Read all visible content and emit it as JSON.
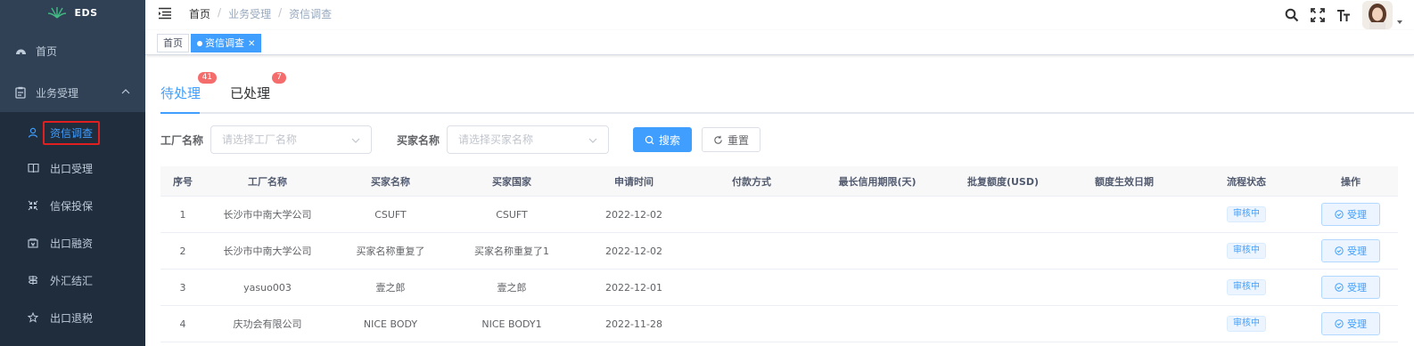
{
  "app": {
    "name": "EDS"
  },
  "sidebar": {
    "items": [
      {
        "label": "首页",
        "icon": "dashboard-icon"
      },
      {
        "label": "业务受理",
        "icon": "clipboard-icon"
      }
    ],
    "subitems": [
      {
        "label": "资信调查",
        "icon": "user-icon",
        "active": true
      },
      {
        "label": "出口受理",
        "icon": "book-icon"
      },
      {
        "label": "信保投保",
        "icon": "shrink-icon"
      },
      {
        "label": "出口融资",
        "icon": "money-icon"
      },
      {
        "label": "外汇结汇",
        "icon": "guide-icon"
      },
      {
        "label": "出口退税",
        "icon": "star-icon"
      }
    ]
  },
  "header": {
    "breadcrumb": [
      "首页",
      "业务受理",
      "资信调查"
    ],
    "separator": "/"
  },
  "tags": [
    {
      "label": "首页"
    },
    {
      "label": "资信调查"
    }
  ],
  "tabs": [
    {
      "label": "待处理",
      "badge": "41"
    },
    {
      "label": "已处理",
      "badge": "7"
    }
  ],
  "filter": {
    "factory_label": "工厂名称",
    "factory_placeholder": "请选择工厂名称",
    "buyer_label": "买家名称",
    "buyer_placeholder": "请选择买家名称",
    "search_label": "搜索",
    "reset_label": "重置"
  },
  "table": {
    "columns": [
      "序号",
      "工厂名称",
      "买家名称",
      "买家国家",
      "申请时间",
      "付款方式",
      "最长信用期限(天)",
      "批复额度(USD)",
      "额度生效日期",
      "流程状态",
      "操作"
    ],
    "rows": [
      [
        "1",
        "长沙市中南大学公司",
        "CSUFT",
        "CSUFT",
        "2022-12-02",
        "",
        "",
        "",
        "",
        "审核中",
        "受理"
      ],
      [
        "2",
        "长沙市中南大学公司",
        "买家名称重复了",
        "买家名称重复了1",
        "2022-12-02",
        "",
        "",
        "",
        "",
        "审核中",
        "受理"
      ],
      [
        "3",
        "yasuo003",
        "壹之郎",
        "壹之郎",
        "2022-12-01",
        "",
        "",
        "",
        "",
        "审核中",
        "受理"
      ],
      [
        "4",
        "庆功会有限公司",
        "NICE BODY",
        "NICE BODY1",
        "2022-11-28",
        "",
        "",
        "",
        "",
        "审核中",
        "受理"
      ]
    ]
  },
  "colors": {
    "accent": "#409eff",
    "sidebar_bg": "#304156",
    "submenu_bg": "#1f2d3d",
    "badge": "#f56c6c",
    "highlight_box": "#e02020"
  }
}
